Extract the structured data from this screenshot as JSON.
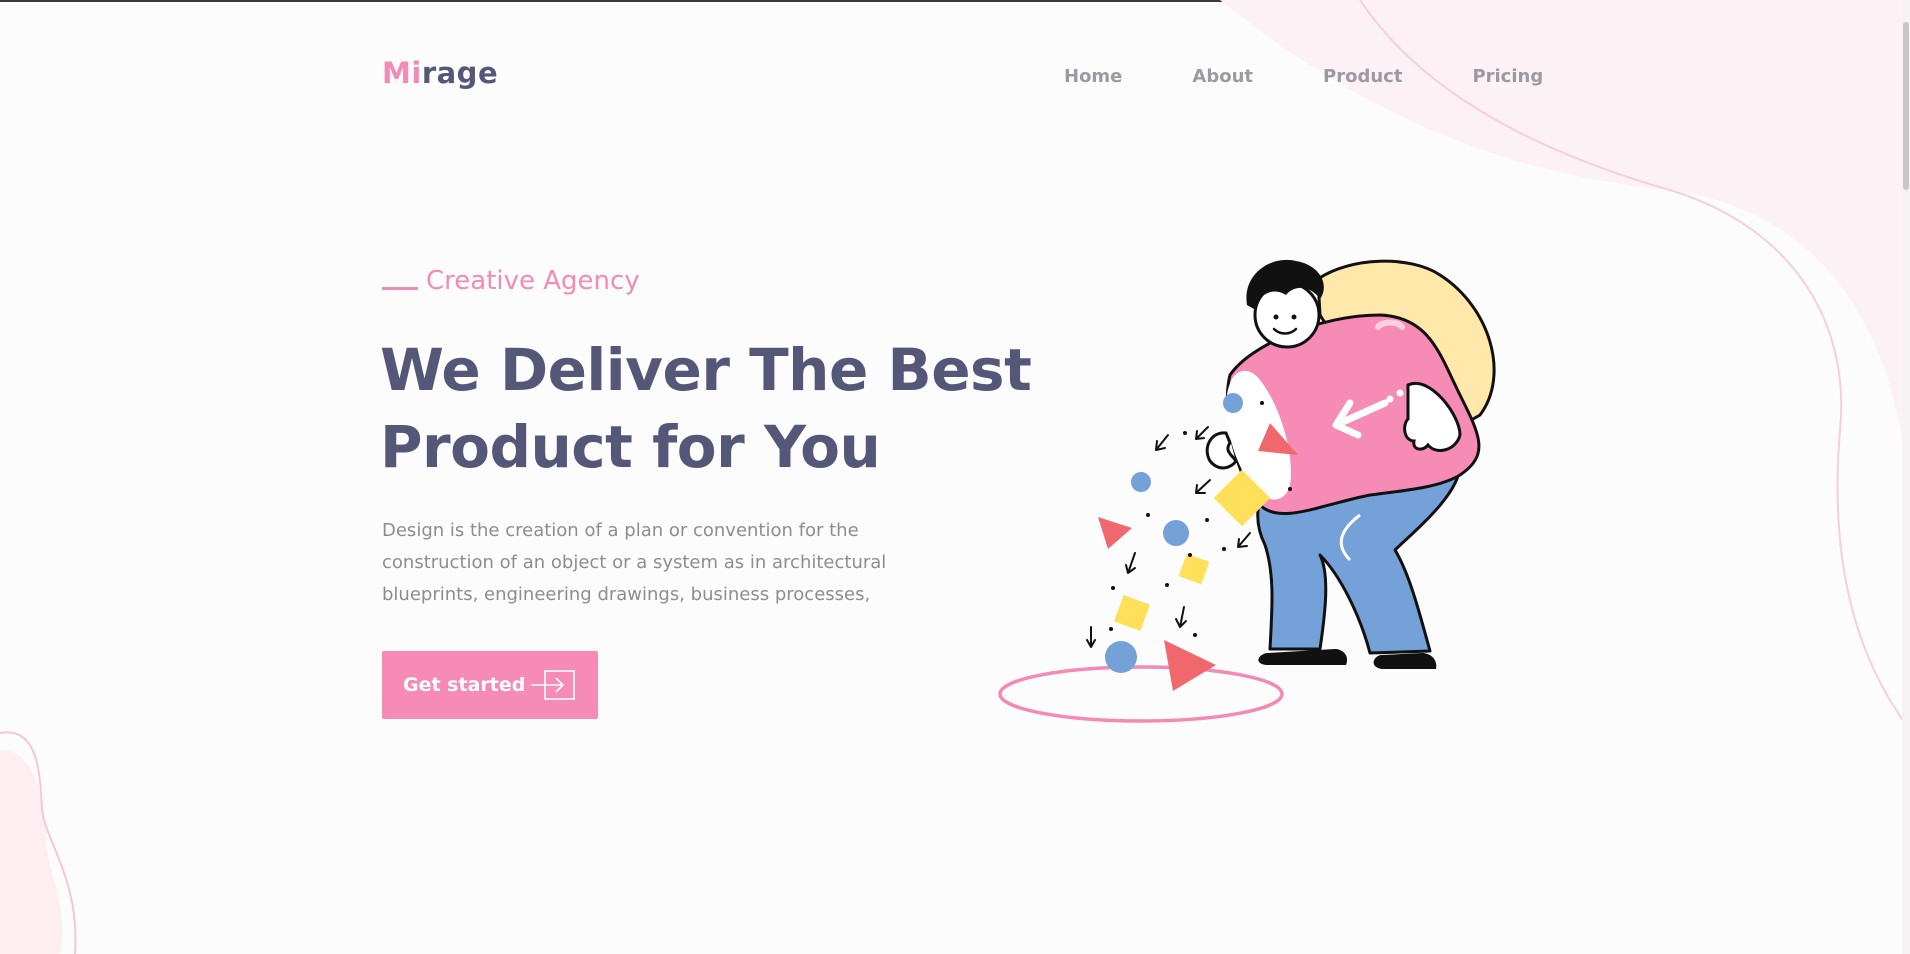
{
  "brand": {
    "logo_accent": "Mi",
    "logo_rest": "rage",
    "accent_color": "#f28bb5",
    "primary_color": "#555778"
  },
  "nav": {
    "items": [
      {
        "label": "Home"
      },
      {
        "label": "About"
      },
      {
        "label": "Product"
      },
      {
        "label": "Pricing"
      }
    ]
  },
  "hero": {
    "eyebrow": "Creative Agency",
    "headline_line1": "We Deliver The Best",
    "headline_line2": "Product for You",
    "description_line1": "Design is the creation of a plan or convention for the",
    "description_line2": "construction of an object or a system as in architectural",
    "description_line3": "blueprints, engineering drawings, business processes,",
    "cta_label": "Get started",
    "cta_icon": "arrow-into-box-icon",
    "illustration": "person-pouring-shapes-illustration"
  }
}
